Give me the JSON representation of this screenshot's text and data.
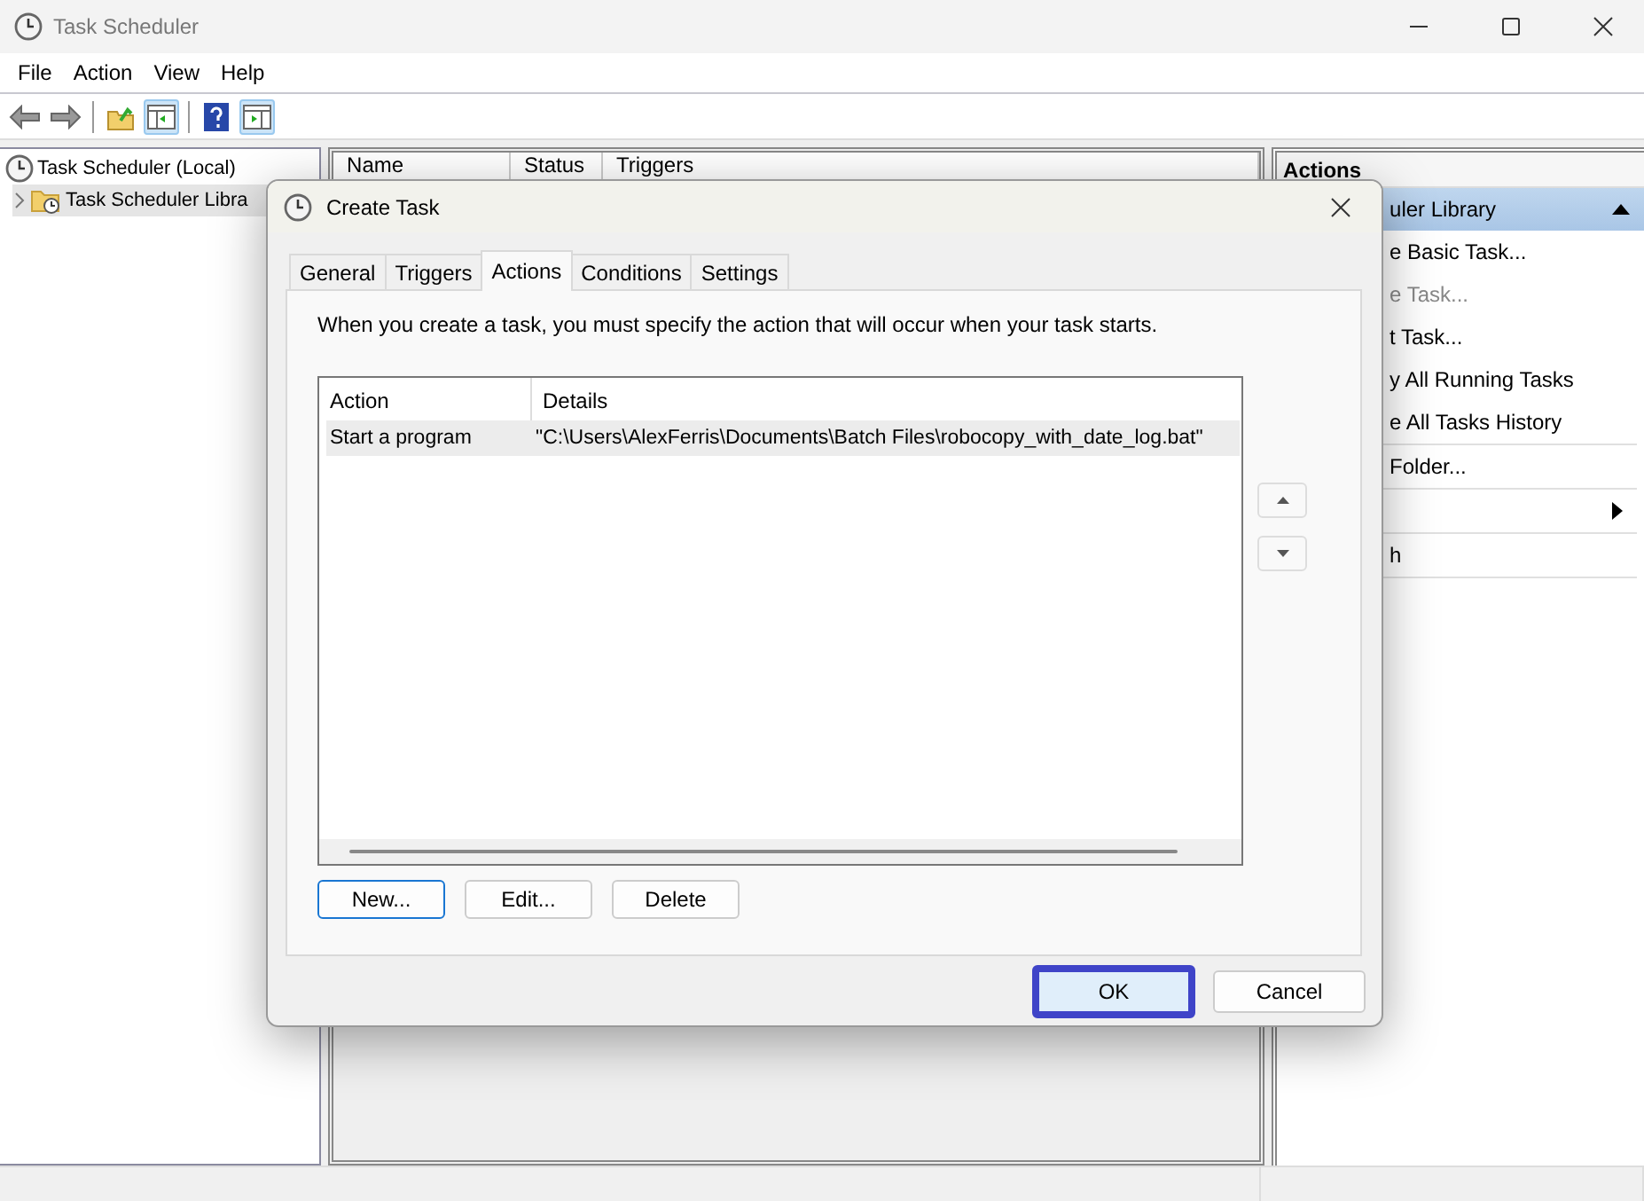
{
  "window": {
    "title": "Task Scheduler"
  },
  "menu": [
    "File",
    "Action",
    "View",
    "Help"
  ],
  "tree": [
    {
      "label": "Task Scheduler (Local)",
      "selected": false,
      "children": [
        {
          "label": "Task Scheduler Libra",
          "selected": true,
          "expanded": false
        }
      ]
    }
  ],
  "task_list": {
    "columns": [
      "Name",
      "Status",
      "Triggers"
    ]
  },
  "actions_pane": {
    "title": "Actions",
    "section": "uler Library",
    "groups": [
      [
        {
          "kind": "command",
          "label": "e Basic Task...",
          "disabled": false
        },
        {
          "kind": "command",
          "label": "e Task...",
          "disabled": true
        },
        {
          "kind": "command",
          "label": "t Task...",
          "disabled": false
        },
        {
          "kind": "command",
          "label": "y All Running Tasks",
          "disabled": false
        },
        {
          "kind": "command",
          "label": "e All Tasks History",
          "disabled": false
        }
      ],
      [
        {
          "kind": "command",
          "label": "Folder...",
          "disabled": false
        }
      ],
      [
        {
          "kind": "submenu"
        }
      ],
      [
        {
          "kind": "command",
          "label": "h",
          "disabled": false
        }
      ]
    ]
  },
  "dialog": {
    "title": "Create Task",
    "tabs": [
      {
        "label": "General",
        "selected": false
      },
      {
        "label": "Triggers",
        "selected": false
      },
      {
        "label": "Actions",
        "selected": true
      },
      {
        "label": "Conditions",
        "selected": false
      },
      {
        "label": "Settings",
        "selected": false
      }
    ],
    "description": "When you create a task, you must specify the action that will occur when your task starts.",
    "actions_table": {
      "columns": [
        "Action",
        "Details"
      ],
      "rows": [
        {
          "cells": [
            "Start a program",
            "\"C:\\Users\\AlexFerris\\Documents\\Batch Files\\robocopy_with_date_log.bat\""
          ],
          "selected": true
        }
      ]
    },
    "list_buttons": [
      {
        "label": "New...",
        "focused": true
      },
      {
        "label": "Edit...",
        "focused": false
      },
      {
        "label": "Delete",
        "focused": false
      }
    ],
    "footer_buttons": [
      {
        "label": "OK",
        "focused": true
      },
      {
        "label": "Cancel",
        "focused": false
      }
    ]
  }
}
